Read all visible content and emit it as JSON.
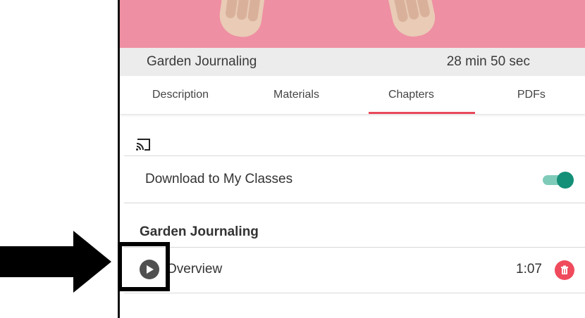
{
  "course": {
    "title": "Garden Journaling",
    "duration": "28 min 50 sec"
  },
  "tabs": [
    {
      "label": "Description",
      "active": false
    },
    {
      "label": "Materials",
      "active": false
    },
    {
      "label": "Chapters",
      "active": true
    },
    {
      "label": "PDFs",
      "active": false
    }
  ],
  "download": {
    "label": "Download to My Classes",
    "enabled": true
  },
  "section": {
    "title": "Garden Journaling"
  },
  "chapters": [
    {
      "label": "Overview",
      "duration": "1:07"
    }
  ],
  "icons": {
    "cast": "cast-icon",
    "play": "play-icon",
    "delete": "trash-icon",
    "arrow": "arrow-right-icon"
  },
  "colors": {
    "accent": "#e8495a",
    "toggle_on": "#148f78",
    "banner": "#ef8fa3",
    "delete": "#ef4b5c"
  }
}
